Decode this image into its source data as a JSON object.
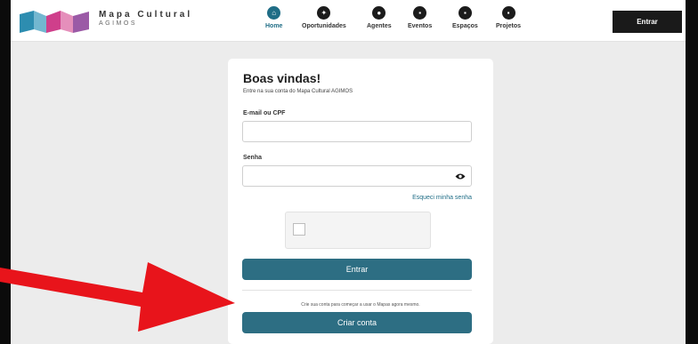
{
  "header": {
    "brand_title": "Mapa Cultural",
    "brand_subtitle": "AGIMOS",
    "nav": [
      {
        "label": "Home",
        "icon": "home-icon",
        "active": true
      },
      {
        "label": "Oportunidades",
        "icon": "opportunities-icon",
        "active": false
      },
      {
        "label": "Agentes",
        "icon": "agents-icon",
        "active": false
      },
      {
        "label": "Eventos",
        "icon": "events-icon",
        "active": false
      },
      {
        "label": "Espaços",
        "icon": "spaces-icon",
        "active": false
      },
      {
        "label": "Projetos",
        "icon": "projects-icon",
        "active": false
      }
    ],
    "enter_label": "Entrar"
  },
  "login": {
    "title": "Boas vindas!",
    "subtitle": "Entre na sua conta do Mapa Cultural AGIMOS",
    "email_label": "E-mail ou CPF",
    "email_value": "",
    "password_label": "Senha",
    "password_value": "",
    "forgot_label": "Esqueci minha senha",
    "submit_label": "Entrar",
    "create_text": "Crie sua conta para começar a usar o Mapas agora mesmo.",
    "create_label": "Criar conta"
  },
  "colors": {
    "accent": "#1f6d86",
    "button": "#2d6e83",
    "annotation_arrow": "#e8141b"
  }
}
